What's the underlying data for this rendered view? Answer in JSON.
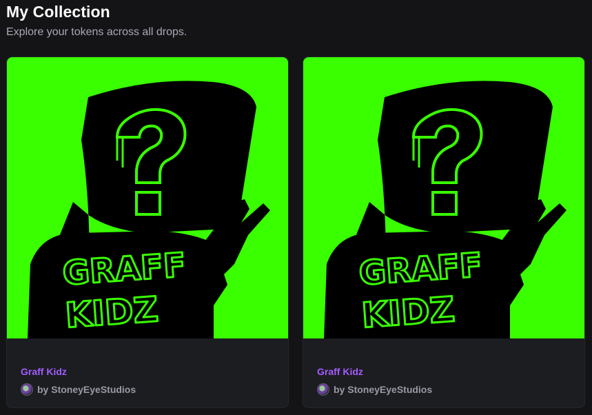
{
  "header": {
    "title": "My Collection",
    "subtitle": "Explore your tokens across all drops."
  },
  "colors": {
    "background": "#141416",
    "card": "#1c1d21",
    "art_background": "#39ff00",
    "accent_purple": "#a35cff"
  },
  "cards": [
    {
      "name": "Graff Kidz",
      "creator": "by StoneyEyeStudios",
      "art_lettering": "GRAFF KIDZ",
      "avatar_icon": "creator-avatar"
    },
    {
      "name": "Graff Kidz",
      "creator": "by StoneyEyeStudios",
      "art_lettering": "GRAFF KIDZ",
      "avatar_icon": "creator-avatar"
    }
  ]
}
